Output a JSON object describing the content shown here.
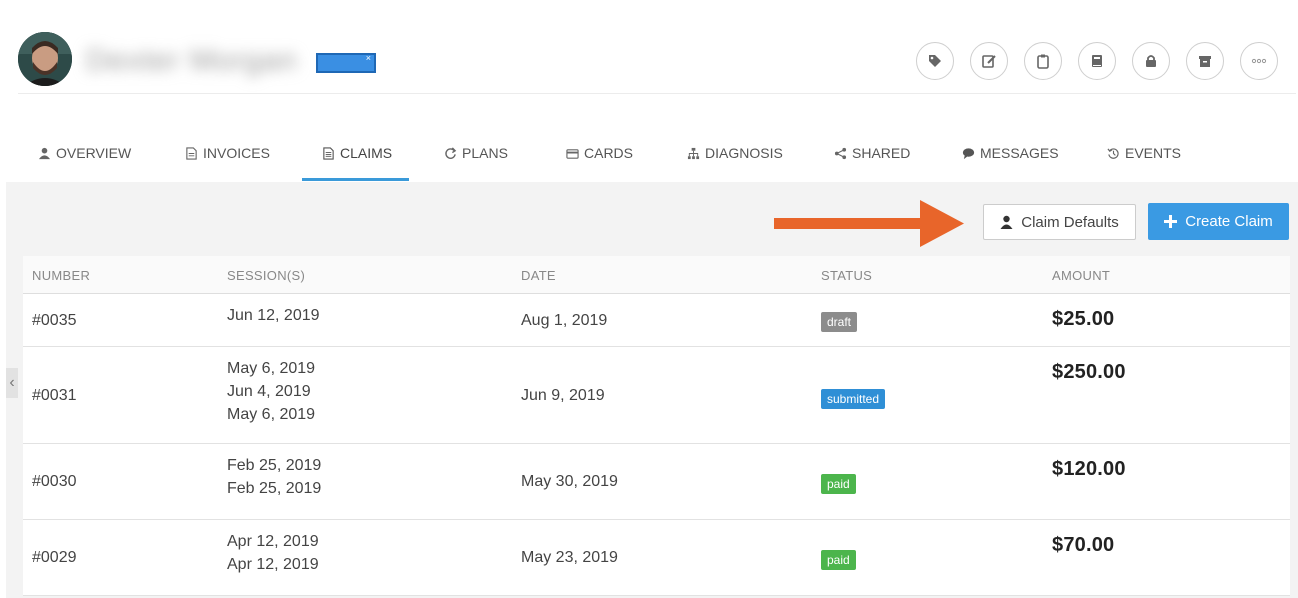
{
  "header": {
    "patient_name": "Dexter Morgan",
    "patient_tag": "",
    "actions": [
      {
        "name": "tag-icon"
      },
      {
        "name": "edit-icon"
      },
      {
        "name": "clipboard-icon"
      },
      {
        "name": "book-icon"
      },
      {
        "name": "lock-icon"
      },
      {
        "name": "archive-icon"
      },
      {
        "name": "more-icon"
      }
    ]
  },
  "tabs": [
    {
      "label": "OVERVIEW",
      "icon": "user-icon"
    },
    {
      "label": "INVOICES",
      "icon": "document-icon"
    },
    {
      "label": "CLAIMS",
      "icon": "claims-icon",
      "active": true
    },
    {
      "label": "PLANS",
      "icon": "refresh-icon"
    },
    {
      "label": "CARDS",
      "icon": "card-icon"
    },
    {
      "label": "DIAGNOSIS",
      "icon": "sitemap-icon"
    },
    {
      "label": "SHARED",
      "icon": "share-icon"
    },
    {
      "label": "MESSAGES",
      "icon": "chat-icon"
    },
    {
      "label": "EVENTS",
      "icon": "history-icon"
    }
  ],
  "toolbar": {
    "claim_defaults_label": "Claim Defaults",
    "create_claim_label": "Create Claim",
    "accent": "#3a9ae3",
    "arrow_color": "#e8652a"
  },
  "table": {
    "columns": [
      "NUMBER",
      "SESSION(S)",
      "DATE",
      "STATUS",
      "AMOUNT"
    ],
    "rows": [
      {
        "number": "#0035",
        "sessions": [
          "Jun 12, 2019"
        ],
        "date": "Aug 1, 2019",
        "status": "draft",
        "amount": "$25.00"
      },
      {
        "number": "#0031",
        "sessions": [
          "May 6, 2019",
          "Jun 4, 2019",
          "May 6, 2019"
        ],
        "date": "Jun 9, 2019",
        "status": "submitted",
        "amount": "$250.00"
      },
      {
        "number": "#0030",
        "sessions": [
          "Feb 25, 2019",
          "Feb 25, 2019"
        ],
        "date": "May 30, 2019",
        "status": "paid",
        "amount": "$120.00"
      },
      {
        "number": "#0029",
        "sessions": [
          "Apr 12, 2019",
          "Apr 12, 2019"
        ],
        "date": "May 23, 2019",
        "status": "paid",
        "amount": "$70.00"
      }
    ]
  },
  "status_colors": {
    "draft": "#8c8c8c",
    "submitted": "#2f8fd6",
    "paid": "#4cb54c"
  }
}
